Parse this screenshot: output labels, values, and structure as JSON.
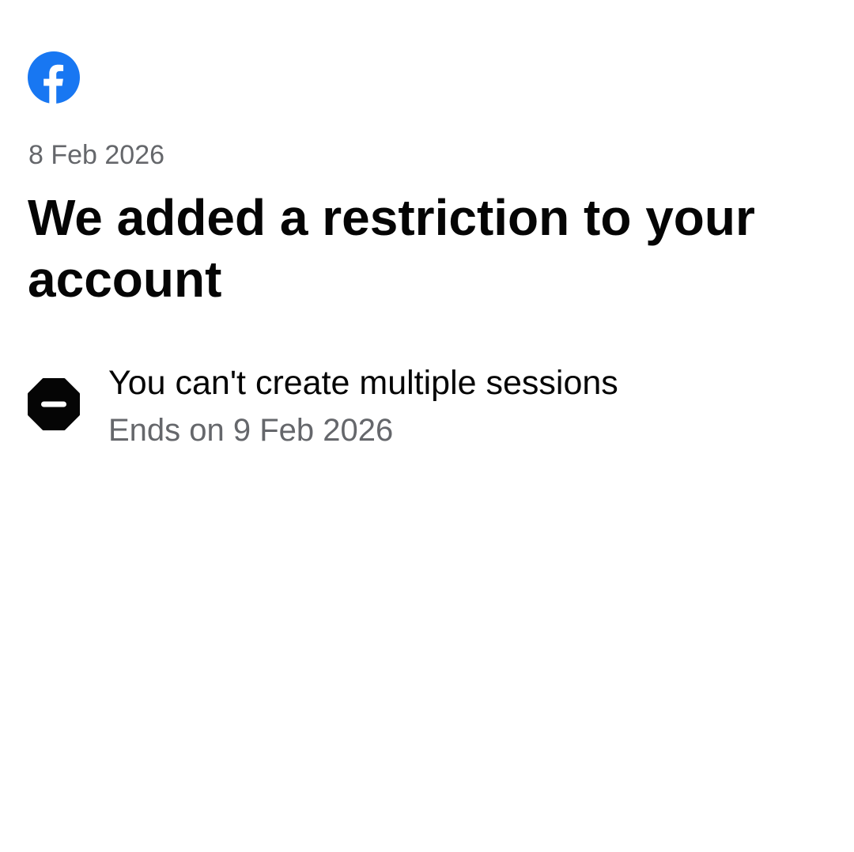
{
  "header": {
    "logo_icon": "facebook-logo-icon",
    "brand_color": "#1877F2",
    "date": "8 Feb 2026"
  },
  "main": {
    "title": "We added a restriction to your account",
    "restriction": {
      "icon": "stop-sign-minus-icon",
      "label": "You can't create multiple sessions",
      "ends": "Ends on 9 Feb 2026"
    }
  },
  "colors": {
    "text_primary": "#050505",
    "text_secondary": "#65676B",
    "background": "#FFFFFF"
  }
}
